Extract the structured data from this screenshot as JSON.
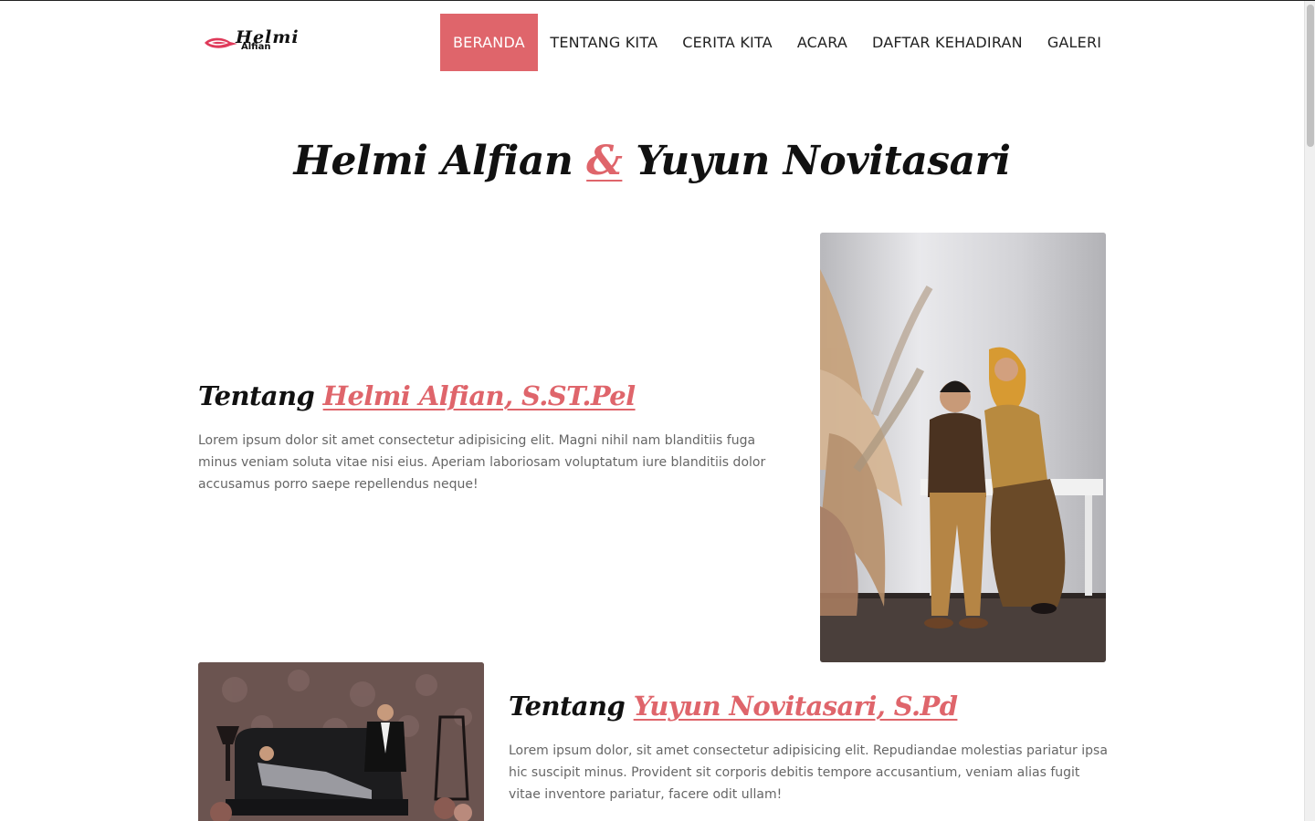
{
  "header": {
    "logo_script": "Helmi",
    "logo_sub": "Alfian",
    "nav": [
      {
        "label": "BERANDA",
        "active": true
      },
      {
        "label": "TENTANG KITA",
        "active": false
      },
      {
        "label": "CERITA KITA",
        "active": false
      },
      {
        "label": "ACARA",
        "active": false
      },
      {
        "label": "DAFTAR KEHADIRAN",
        "active": false
      },
      {
        "label": "GALERI",
        "active": false
      }
    ]
  },
  "hero": {
    "groom": "Helmi Alfian",
    "amp": "&",
    "bride": "Yuyun Novitasari"
  },
  "about_groom": {
    "prefix": "Tentang",
    "name": "Helmi Alfian, S.ST.Pel",
    "text": "Lorem ipsum dolor sit amet consectetur adipisicing elit. Magni nihil nam blanditiis fuga minus veniam soluta vitae nisi eius. Aperiam laboriosam voluptatum iure blanditiis dolor accusamus porro saepe repellendus neque!"
  },
  "about_bride": {
    "prefix": "Tentang",
    "name": "Yuyun Novitasari, S.Pd",
    "text": "Lorem ipsum dolor, sit amet consectetur adipisicing elit. Repudiandae molestias pariatur ipsa hic suscipit minus. Provident sit corporis debitis tempore accusantium, veniam alias fugit vitae inventore pariatur, facere odit ullam!"
  },
  "colors": {
    "accent": "#df656b",
    "text_dark": "#111111",
    "text_muted": "#666666"
  }
}
